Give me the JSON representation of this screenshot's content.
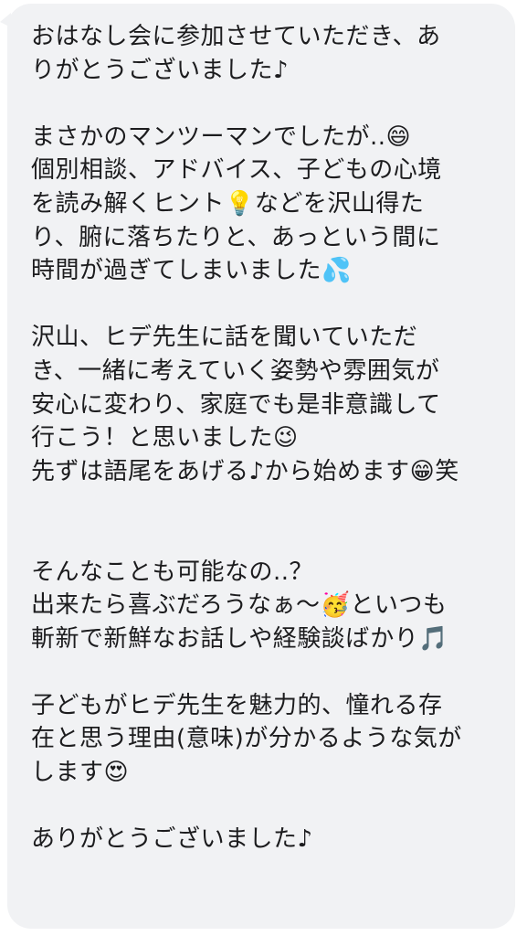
{
  "message": {
    "text": "おはなし会に参加させていただき、あ\nりがとうございました♪\n\nまさかのマンツーマンでしたが..😄\n個別相談、アドバイス、子どもの心境\nを読み解くヒント💡などを沢山得た\nり、腑に落ちたりと、あっという間に\n時間が過ぎてしまいました💦\n\n沢山、ヒデ先生に話を聞いていただ\nき、一緒に考えていく姿勢や雰囲気が\n安心に変わり、家庭でも是非意識して\n行こう！と思いました😉\n先ずは語尾をあげる♪から始めます😁笑\n\n\nそんなことも可能なの..？\n出来たら喜ぶだろうなぁ〜🥳といつも\n斬新で新鮮なお話しや経験談ばかり🎵\n\n子どもがヒデ先生を魅力的、憧れる存\n在と思う理由(意味)が分かるような気が\nします😍\n\nありがとうございました♪"
  },
  "colors": {
    "bubble": "#f1f2f4",
    "text": "#1c1c1e",
    "background": "#ffffff"
  }
}
